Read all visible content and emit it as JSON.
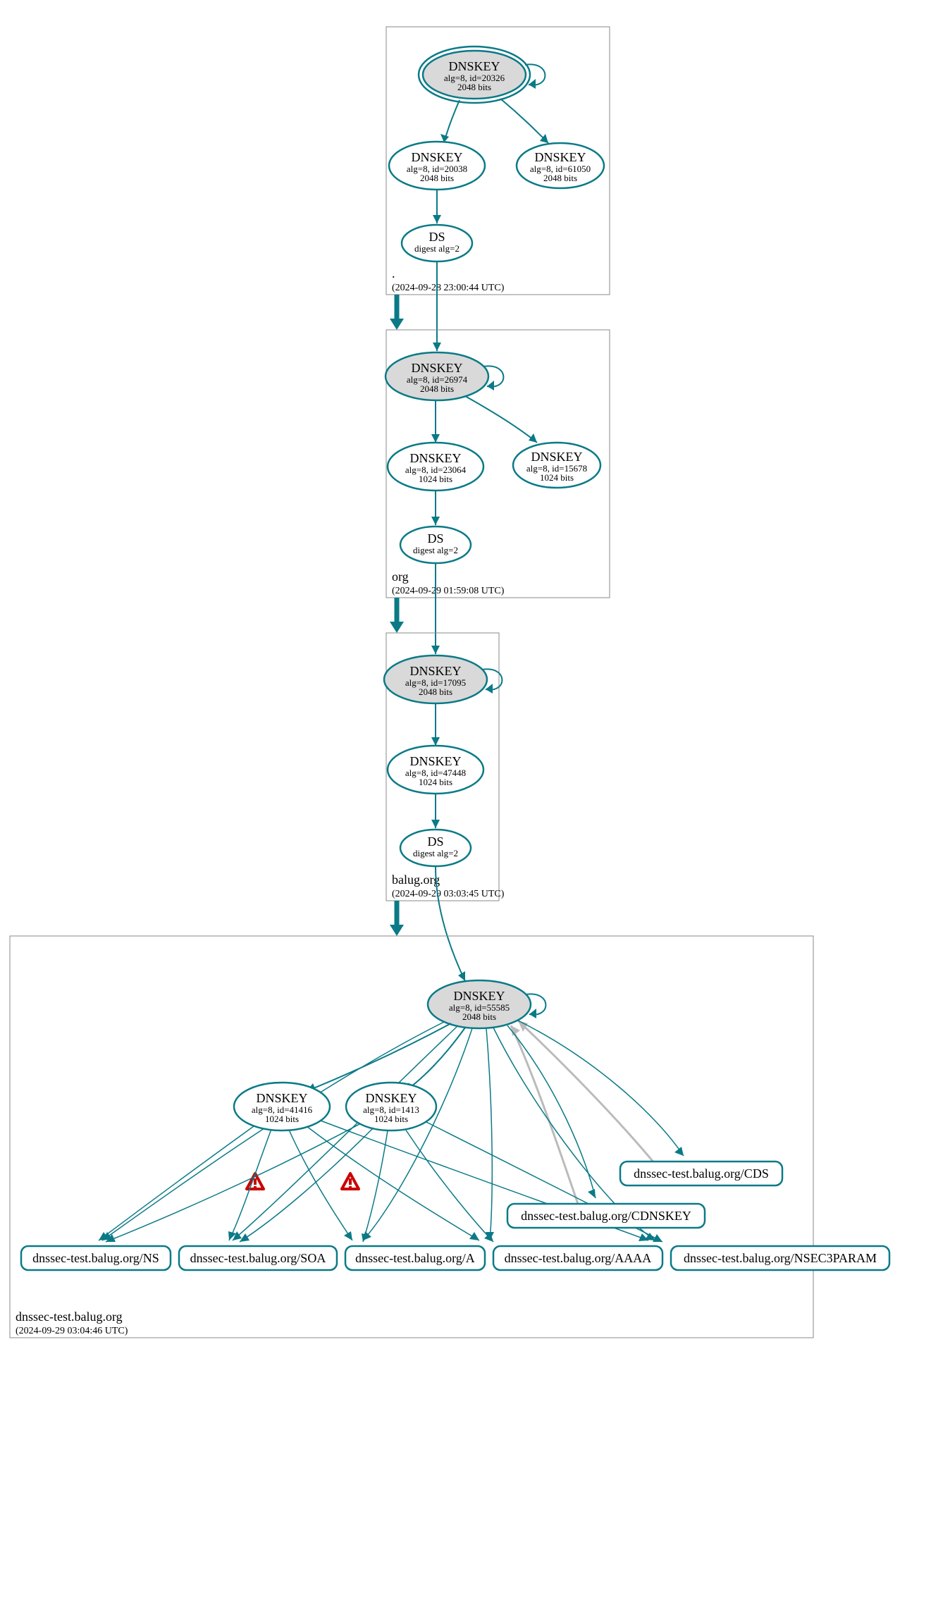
{
  "zones": {
    "root": {
      "name": ".",
      "timestamp": "(2024-09-28 23:00:44 UTC)",
      "ksk": {
        "title": "DNSKEY",
        "line1": "alg=8, id=20326",
        "line2": "2048 bits"
      },
      "zsk1": {
        "title": "DNSKEY",
        "line1": "alg=8, id=20038",
        "line2": "2048 bits"
      },
      "zsk2": {
        "title": "DNSKEY",
        "line1": "alg=8, id=61050",
        "line2": "2048 bits"
      },
      "ds": {
        "title": "DS",
        "line1": "digest alg=2"
      }
    },
    "org": {
      "name": "org",
      "timestamp": "(2024-09-29 01:59:08 UTC)",
      "ksk": {
        "title": "DNSKEY",
        "line1": "alg=8, id=26974",
        "line2": "2048 bits"
      },
      "zsk1": {
        "title": "DNSKEY",
        "line1": "alg=8, id=23064",
        "line2": "1024 bits"
      },
      "zsk2": {
        "title": "DNSKEY",
        "line1": "alg=8, id=15678",
        "line2": "1024 bits"
      },
      "ds": {
        "title": "DS",
        "line1": "digest alg=2"
      }
    },
    "balug": {
      "name": "balug.org",
      "timestamp": "(2024-09-29 03:03:45 UTC)",
      "ksk": {
        "title": "DNSKEY",
        "line1": "alg=8, id=17095",
        "line2": "2048 bits"
      },
      "zsk1": {
        "title": "DNSKEY",
        "line1": "alg=8, id=47448",
        "line2": "1024 bits"
      },
      "ds": {
        "title": "DS",
        "line1": "digest alg=2"
      }
    },
    "dnssec": {
      "name": "dnssec-test.balug.org",
      "timestamp": "(2024-09-29 03:04:46 UTC)",
      "ksk": {
        "title": "DNSKEY",
        "line1": "alg=8, id=55585",
        "line2": "2048 bits"
      },
      "zsk1": {
        "title": "DNSKEY",
        "line1": "alg=8, id=41416",
        "line2": "1024 bits"
      },
      "zsk2": {
        "title": "DNSKEY",
        "line1": "alg=8, id=1413",
        "line2": "1024 bits"
      }
    }
  },
  "rrsets": {
    "ns": "dnssec-test.balug.org/NS",
    "soa": "dnssec-test.balug.org/SOA",
    "a": "dnssec-test.balug.org/A",
    "aaaa": "dnssec-test.balug.org/AAAA",
    "nsec3p": "dnssec-test.balug.org/NSEC3PARAM",
    "cdnskey": "dnssec-test.balug.org/CDNSKEY",
    "cds": "dnssec-test.balug.org/CDS"
  }
}
